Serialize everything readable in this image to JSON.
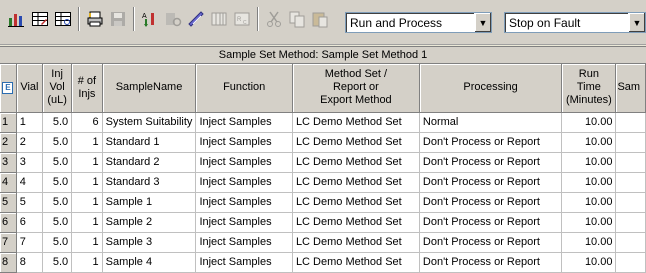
{
  "toolbar": {
    "buttons": [
      {
        "icon": "bar-chart-icon"
      },
      {
        "icon": "table-edit-icon"
      },
      {
        "icon": "table-view-icon"
      },
      {
        "icon": "print-icon"
      },
      {
        "icon": "save-icon"
      },
      {
        "icon": "sort-icon"
      },
      {
        "icon": "wizard-icon"
      },
      {
        "icon": "filter-icon"
      },
      {
        "icon": "columns-icon"
      },
      {
        "icon": "insert-row-icon"
      },
      {
        "icon": "cut-icon"
      },
      {
        "icon": "copy-icon"
      },
      {
        "icon": "paste-icon"
      }
    ],
    "run_mode": "Run and Process",
    "fault_mode": "Stop on Fault"
  },
  "grid": {
    "title": "Sample Set Method: Sample Set Method 1",
    "corner": "E",
    "columns": [
      "Vial",
      "Inj\nVol\n(uL)",
      "# of\nInjs",
      "SampleName",
      "Function",
      "Method Set /\nReport or\nExport Method",
      "Processing",
      "Run\nTime\n(Minutes)",
      "Sam"
    ],
    "rows": [
      {
        "n": "1",
        "vial": "1",
        "vol": "5.0",
        "injs": "6",
        "name": "System Suitability",
        "func": "Inject Samples",
        "method": "LC Demo Method Set",
        "proc": "Normal",
        "time": "10.00"
      },
      {
        "n": "2",
        "vial": "2",
        "vol": "5.0",
        "injs": "1",
        "name": "Standard 1",
        "func": "Inject Samples",
        "method": "LC Demo Method Set",
        "proc": "Don't Process or Report",
        "time": "10.00"
      },
      {
        "n": "3",
        "vial": "3",
        "vol": "5.0",
        "injs": "1",
        "name": "Standard 2",
        "func": "Inject Samples",
        "method": "LC Demo Method Set",
        "proc": "Don't Process or Report",
        "time": "10.00"
      },
      {
        "n": "4",
        "vial": "4",
        "vol": "5.0",
        "injs": "1",
        "name": "Standard 3",
        "func": "Inject Samples",
        "method": "LC Demo Method Set",
        "proc": "Don't Process or Report",
        "time": "10.00"
      },
      {
        "n": "5",
        "vial": "5",
        "vol": "5.0",
        "injs": "1",
        "name": "Sample 1",
        "func": "Inject Samples",
        "method": "LC Demo Method Set",
        "proc": "Don't Process or Report",
        "time": "10.00"
      },
      {
        "n": "6",
        "vial": "6",
        "vol": "5.0",
        "injs": "1",
        "name": "Sample 2",
        "func": "Inject Samples",
        "method": "LC Demo Method Set",
        "proc": "Don't Process or Report",
        "time": "10.00"
      },
      {
        "n": "7",
        "vial": "7",
        "vol": "5.0",
        "injs": "1",
        "name": "Sample 3",
        "func": "Inject Samples",
        "method": "LC Demo Method Set",
        "proc": "Don't Process or Report",
        "time": "10.00"
      },
      {
        "n": "8",
        "vial": "8",
        "vol": "5.0",
        "injs": "1",
        "name": "Sample 4",
        "func": "Inject Samples",
        "method": "LC Demo Method Set",
        "proc": "Don't Process or Report",
        "time": "10.00"
      }
    ]
  }
}
